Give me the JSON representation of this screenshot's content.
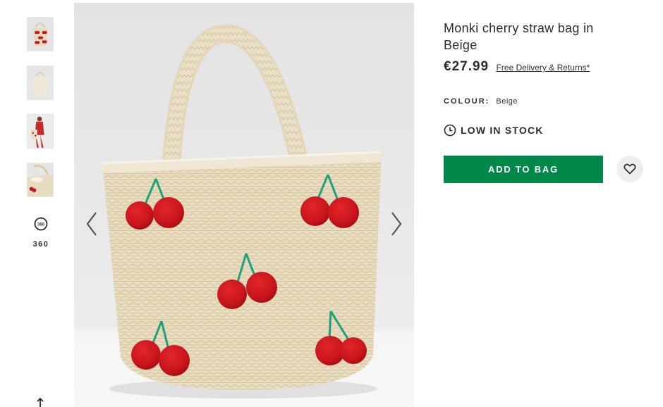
{
  "product": {
    "title": "Monki cherry straw bag in Beige",
    "price": "€27.99",
    "delivery_link": "Free Delivery & Returns*",
    "colour_label": "COLOUR:",
    "colour_value": "Beige",
    "stock_status": "LOW IN STOCK",
    "add_to_bag_label": "ADD TO BAG"
  },
  "gallery": {
    "view_360_label": "360",
    "thumbnails": [
      "bag-front",
      "bag-plain",
      "model-wearing-bag",
      "bag-closeup"
    ]
  },
  "icons": {
    "prev": "chevron-left-icon",
    "next": "chevron-right-icon",
    "save": "heart-icon",
    "stock": "clock-icon",
    "rotate": "360-rotate-icon",
    "scroll": "arrow-up-icon"
  },
  "colors": {
    "accent_green": "#018849",
    "text": "#2d2d2d",
    "cherry_red": "#c8151b",
    "straw": "#e8dcc0"
  }
}
